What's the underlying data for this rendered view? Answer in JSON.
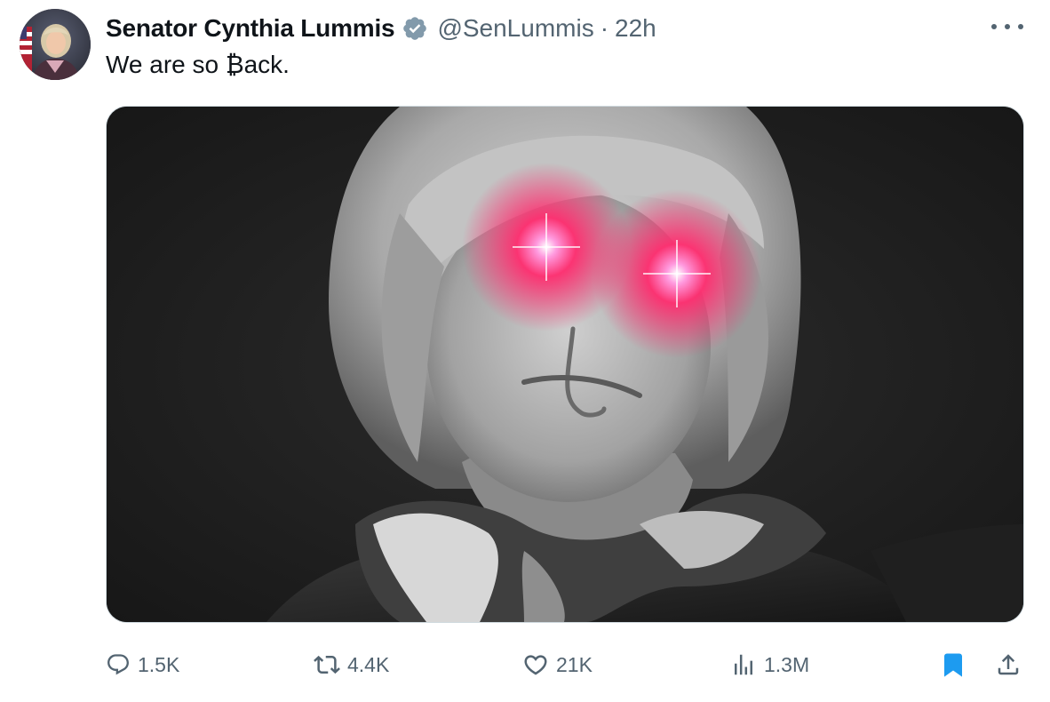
{
  "author": {
    "display_name": "Senator Cynthia Lummis",
    "handle": "@SenLummis",
    "separator": "·",
    "time": "22h",
    "verified": true
  },
  "tweet": {
    "text": "We are so ₿ack."
  },
  "actions": {
    "reply_count": "1.5K",
    "retweet_count": "4.4K",
    "like_count": "21K",
    "views_count": "1.3M",
    "bookmarked": true
  },
  "colors": {
    "text": "#0f1419",
    "secondary": "#536471",
    "bookmark_active": "#1d9bf0",
    "verified_badge": "#829aab",
    "laser_eyes": "#ff2d6f"
  },
  "icons": {
    "reply": "reply-icon",
    "retweet": "retweet-icon",
    "like": "heart-icon",
    "views": "views-chart-icon",
    "bookmark": "bookmark-icon",
    "share": "share-icon",
    "more": "more-dots-icon",
    "verified": "verified-badge-icon"
  }
}
